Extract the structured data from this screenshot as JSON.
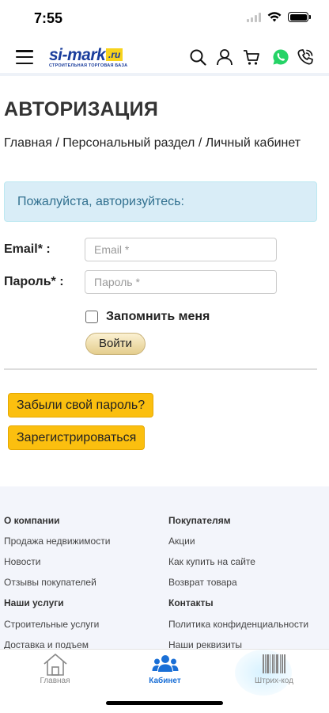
{
  "status_bar": {
    "time": "7:55"
  },
  "header": {
    "logo_text": "si-market",
    "logo_ru": ".ru",
    "logo_sub": "СТРОИТЕЛЬНАЯ ТОРГОВАЯ БАЗА",
    "icons": [
      "menu-icon",
      "search-icon",
      "user-icon",
      "cart-icon",
      "whatsapp-icon",
      "phone-icon"
    ],
    "whatsapp_color": "#25d366"
  },
  "main": {
    "title": "АВТОРИЗАЦИЯ",
    "breadcrumb": "Главная / Персональный раздел / Личный кабинет",
    "alert": "Пожалуйста, авторизуйтесь:",
    "email_label": "Email* :",
    "email_placeholder": "Email *",
    "password_label": "Пароль* :",
    "password_placeholder": "Пароль *",
    "remember_label": "Запомнить меня",
    "login_button": "Войти",
    "forgot_button": "Забыли свой пароль?",
    "register_button": "Зарегистрироваться"
  },
  "footer": {
    "col1": {
      "heading": "О компании",
      "items": [
        "Продажа недвижимости",
        "Новости",
        "Отзывы покупателей"
      ],
      "heading2": "Наши услуги",
      "items2": [
        "Строительные услуги",
        "Доставка и подъем"
      ]
    },
    "col2": {
      "heading": "Покупателям",
      "items": [
        "Акции",
        "Как купить на сайте",
        "Возврат товара"
      ],
      "heading2": "Контакты",
      "items2": [
        "Политика конфиденциальности",
        "Наши реквизиты"
      ]
    }
  },
  "tabbar": {
    "tabs": [
      {
        "label": "Главная",
        "icon": "home-icon"
      },
      {
        "label": "Кабинет",
        "icon": "users-icon"
      },
      {
        "label": "Штрих-код",
        "icon": "barcode-icon"
      }
    ],
    "active_tab": "Кабинет",
    "active_color": "#1a6fd6"
  }
}
